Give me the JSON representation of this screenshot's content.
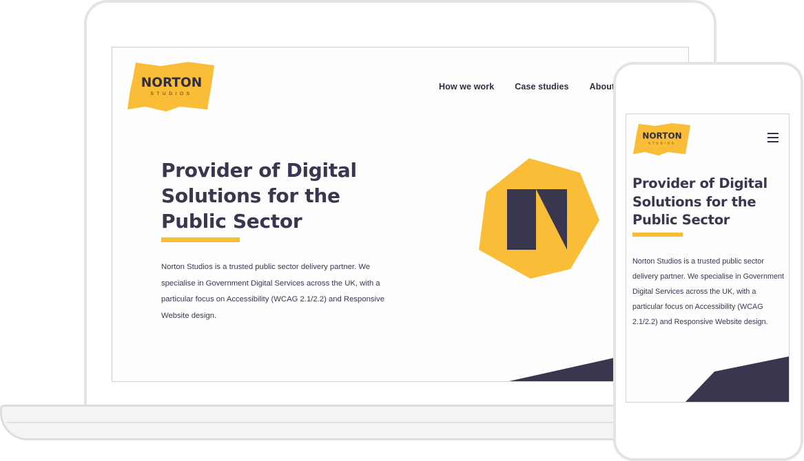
{
  "brand": {
    "name": "NORTON",
    "sub": "STUDIOS",
    "colors": {
      "accent": "#f9bd37",
      "dark": "#39374f",
      "navy": "#2e2d42"
    }
  },
  "nav": {
    "items": [
      {
        "label": "How we work"
      },
      {
        "label": "Case studies"
      },
      {
        "label": "About us"
      }
    ]
  },
  "hero": {
    "title": "Provider of Digital Solutions for the Public Sector",
    "body": "Norton Studios is a trusted public sector delivery partner. We specialise in Government Digital Services across the UK, with a particular focus on Accessibility (WCAG 2.1/2.2) and Responsive Website design."
  },
  "mobile": {
    "menu_icon": "hamburger-icon"
  }
}
